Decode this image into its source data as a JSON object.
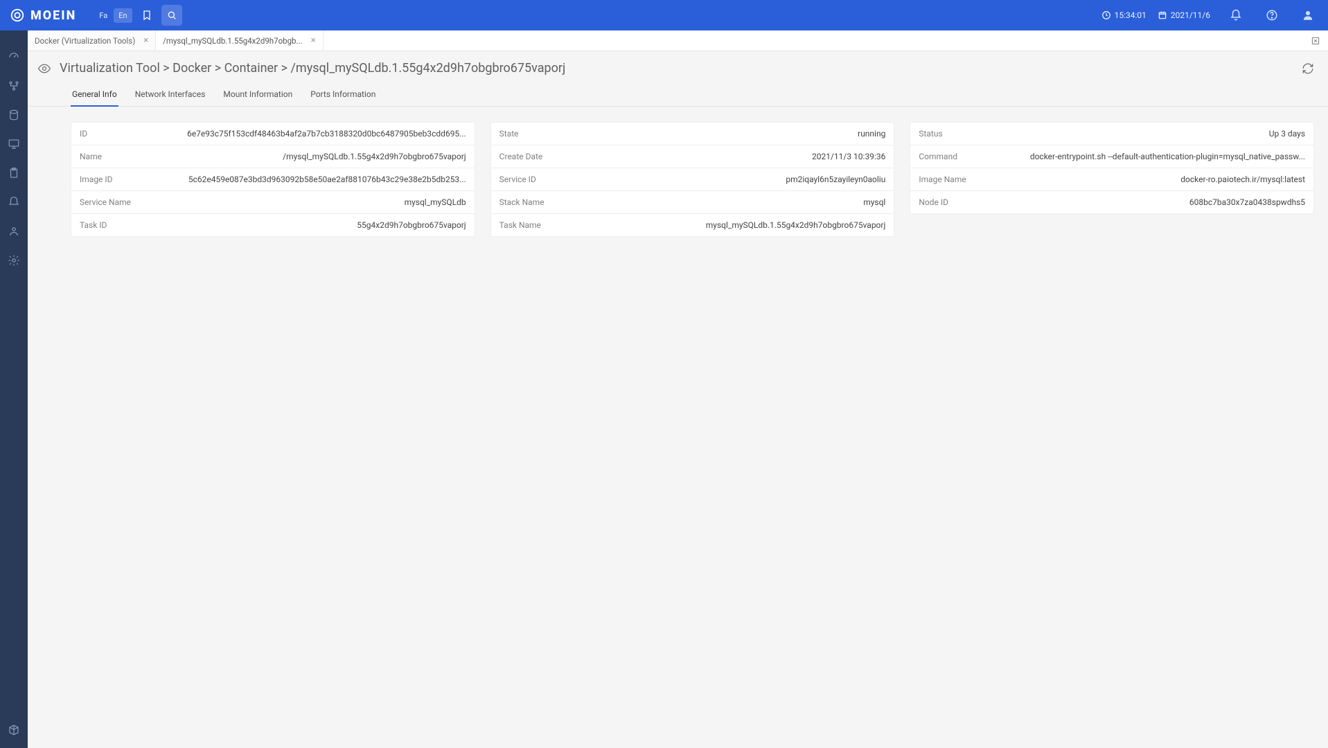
{
  "brand": "MOEIN",
  "topbar": {
    "lang_fa": "Fa",
    "lang_en": "En",
    "time": "15:34:01",
    "date": "2021/11/6"
  },
  "tabs": [
    {
      "label": "Docker (Virtualization Tools)",
      "active": false
    },
    {
      "label": "/mysql_mySQLdb.1.55g4x2d9h7obgb...",
      "active": true
    }
  ],
  "breadcrumb": "Virtualization Tool  >  Docker  >  Container  >  /mysql_mySQLdb.1.55g4x2d9h7obgbro675vaporj",
  "subtabs": [
    {
      "label": "General Info",
      "active": true
    },
    {
      "label": "Network Interfaces",
      "active": false
    },
    {
      "label": "Mount Information",
      "active": false
    },
    {
      "label": "Ports Information",
      "active": false
    }
  ],
  "panels": [
    {
      "rows": [
        {
          "k": "ID",
          "v": "6e7e93c75f153cdf48463b4af2a7b7cb3188320d0bc6487905beb3cdd695..."
        },
        {
          "k": "Name",
          "v": "/mysql_mySQLdb.1.55g4x2d9h7obgbro675vaporj"
        },
        {
          "k": "Image ID",
          "v": "5c62e459e087e3bd3d963092b58e50ae2af881076b43c29e38e2b5db253..."
        },
        {
          "k": "Service Name",
          "v": "mysql_mySQLdb"
        },
        {
          "k": "Task ID",
          "v": "55g4x2d9h7obgbro675vaporj"
        }
      ]
    },
    {
      "rows": [
        {
          "k": "State",
          "v": "running"
        },
        {
          "k": "Create Date",
          "v": "2021/11/3 10:39:36"
        },
        {
          "k": "Service ID",
          "v": "pm2iqayl6n5zayileyn0aoliu"
        },
        {
          "k": "Stack Name",
          "v": "mysql"
        },
        {
          "k": "Task Name",
          "v": "mysql_mySQLdb.1.55g4x2d9h7obgbro675vaporj"
        }
      ]
    },
    {
      "rows": [
        {
          "k": "Status",
          "v": "Up 3 days"
        },
        {
          "k": "Command",
          "v": "docker-entrypoint.sh --default-authentication-plugin=mysql_native_passw..."
        },
        {
          "k": "Image Name",
          "v": "docker-ro.paiotech.ir/mysql:latest"
        },
        {
          "k": "Node ID",
          "v": "608bc7ba30x7za0438spwdhs5"
        }
      ]
    }
  ]
}
